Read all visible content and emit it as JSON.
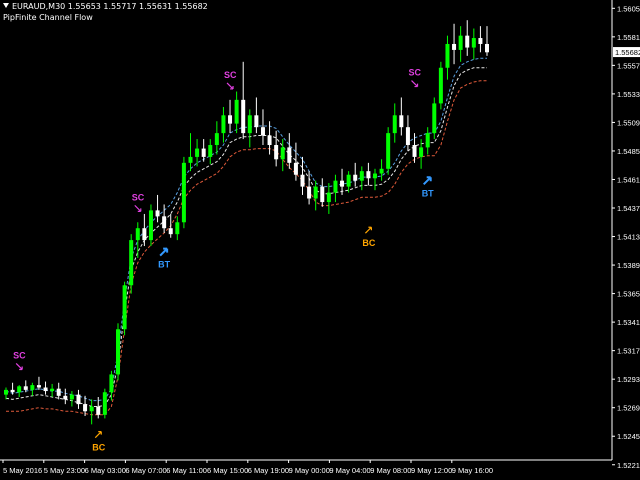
{
  "window": {
    "symbol_line": "EURAUD,M30  1.55653 1.55717 1.55631 1.55682",
    "indicator_name": "PipFinite Channel Flow"
  },
  "colors": {
    "background": "#000000",
    "bull_candle": "#00ff00",
    "bear_candle": "#ffffff",
    "upper_line": "#5aa0e0",
    "middle_line": "#e8e8e8",
    "lower_line": "#e05a3a",
    "sc_label": "#e040e0",
    "bt_label": "#3399ff",
    "bc_label": "#ffa500",
    "axis": "#ffffff",
    "current_price_bg": "#ffffff"
  },
  "chart_data": {
    "type": "line",
    "ylim": [
      1.5225,
      1.5612
    ],
    "y_ticks": [
      "1.56050",
      "1.55810",
      "1.55570",
      "1.55330",
      "1.55090",
      "1.54850",
      "1.54610",
      "1.54370",
      "1.54130",
      "1.53890",
      "1.53650",
      "1.53410",
      "1.53170",
      "1.52930",
      "1.52690",
      "1.52450",
      "1.52210"
    ],
    "y_tick_values": [
      1.5605,
      1.5581,
      1.5557,
      1.5533,
      1.5509,
      1.5485,
      1.5461,
      1.5437,
      1.5413,
      1.5389,
      1.5365,
      1.5341,
      1.5317,
      1.5293,
      1.5269,
      1.5245,
      1.5221
    ],
    "x_ticks": [
      "5 May 2016",
      "5 May 23:00",
      "6 May 03:00",
      "6 May 07:00",
      "6 May 11:00",
      "6 May 15:00",
      "6 May 19:00",
      "9 May 00:00",
      "9 May 04:00",
      "9 May 08:00",
      "9 May 12:00",
      "9 May 16:00"
    ],
    "current_price": "1.55682",
    "series": [
      {
        "values": [
          1.5283,
          1.5281,
          1.5282,
          1.5283,
          1.5284,
          1.5285,
          1.5284,
          1.5283,
          1.5283,
          1.5281,
          1.528,
          1.5279,
          1.5277,
          1.5275,
          1.5275,
          1.5276,
          1.5285,
          1.5315,
          1.536,
          1.5395,
          1.541,
          1.5418,
          1.5425,
          1.543,
          1.5435,
          1.544,
          1.545,
          1.5463,
          1.547,
          1.5475,
          1.5478,
          1.5481,
          1.5484,
          1.549,
          1.55,
          1.5503,
          1.5505,
          1.5505,
          1.5506,
          1.5506,
          1.5506,
          1.5504,
          1.5497,
          1.549,
          1.5484,
          1.5478,
          1.5468,
          1.5458,
          1.5455,
          1.5455,
          1.5456,
          1.5457,
          1.5458,
          1.546,
          1.5463,
          1.5463,
          1.5463,
          1.5464,
          1.5468,
          1.5475,
          1.5485,
          1.5492,
          1.5496,
          1.5498,
          1.55,
          1.55,
          1.551,
          1.553,
          1.5548,
          1.5557,
          1.556,
          1.5562,
          1.5563,
          1.5563
        ]
      },
      {
        "values": [
          1.5277,
          1.5276,
          1.5277,
          1.5278,
          1.5279,
          1.528,
          1.5279,
          1.5278,
          1.5277,
          1.5276,
          1.5275,
          1.5273,
          1.5272,
          1.527,
          1.527,
          1.5271,
          1.528,
          1.5305,
          1.535,
          1.5385,
          1.54,
          1.541,
          1.5416,
          1.5421,
          1.5426,
          1.5432,
          1.5442,
          1.5455,
          1.5462,
          1.5467,
          1.547,
          1.5473,
          1.5476,
          1.5482,
          1.5492,
          1.5495,
          1.5497,
          1.5497,
          1.5498,
          1.5498,
          1.5498,
          1.5496,
          1.5489,
          1.5482,
          1.5477,
          1.5471,
          1.5462,
          1.5452,
          1.5449,
          1.5449,
          1.545,
          1.5451,
          1.5452,
          1.5454,
          1.5456,
          1.5456,
          1.5456,
          1.5457,
          1.5461,
          1.5468,
          1.5478,
          1.5485,
          1.5489,
          1.5491,
          1.5492,
          1.5492,
          1.5502,
          1.5522,
          1.554,
          1.555,
          1.5553,
          1.5555,
          1.5555,
          1.5555
        ]
      },
      {
        "values": [
          1.5266,
          1.5266,
          1.5266,
          1.5267,
          1.5268,
          1.5269,
          1.5268,
          1.5268,
          1.5267,
          1.5266,
          1.5266,
          1.5265,
          1.5264,
          1.5263,
          1.5263,
          1.5263,
          1.527,
          1.5295,
          1.5335,
          1.5373,
          1.5391,
          1.54,
          1.5406,
          1.5411,
          1.5416,
          1.5422,
          1.5432,
          1.5445,
          1.5452,
          1.5457,
          1.546,
          1.5463,
          1.5466,
          1.5472,
          1.548,
          1.5484,
          1.5486,
          1.5486,
          1.5487,
          1.5487,
          1.5487,
          1.5485,
          1.5478,
          1.5471,
          1.5466,
          1.546,
          1.5452,
          1.5442,
          1.5439,
          1.5439,
          1.544,
          1.5441,
          1.5442,
          1.5444,
          1.5446,
          1.5446,
          1.5446,
          1.5447,
          1.545,
          1.5457,
          1.5467,
          1.5474,
          1.5478,
          1.548,
          1.5481,
          1.5481,
          1.549,
          1.551,
          1.5528,
          1.5538,
          1.5541,
          1.5543,
          1.5544,
          1.5544
        ]
      }
    ],
    "candles": [
      [
        1.528,
        1.5286,
        1.5276,
        1.5284
      ],
      [
        1.5284,
        1.529,
        1.528,
        1.5282
      ],
      [
        1.5282,
        1.5288,
        1.5278,
        1.5287
      ],
      [
        1.5287,
        1.5292,
        1.5282,
        1.5284
      ],
      [
        1.5284,
        1.529,
        1.5279,
        1.5288
      ],
      [
        1.5288,
        1.5295,
        1.5284,
        1.5286
      ],
      [
        1.5286,
        1.5291,
        1.528,
        1.5283
      ],
      [
        1.5283,
        1.5289,
        1.5278,
        1.5285
      ],
      [
        1.5285,
        1.529,
        1.5276,
        1.5279
      ],
      [
        1.5279,
        1.5285,
        1.5272,
        1.5276
      ],
      [
        1.5276,
        1.5283,
        1.527,
        1.528
      ],
      [
        1.528,
        1.5284,
        1.5268,
        1.5272
      ],
      [
        1.5272,
        1.5279,
        1.5262,
        1.5266
      ],
      [
        1.5266,
        1.5276,
        1.5255,
        1.527
      ],
      [
        1.527,
        1.5278,
        1.526,
        1.5263
      ],
      [
        1.5263,
        1.5285,
        1.526,
        1.5282
      ],
      [
        1.5282,
        1.53,
        1.5275,
        1.5297
      ],
      [
        1.5297,
        1.534,
        1.5292,
        1.5335
      ],
      [
        1.5335,
        1.5375,
        1.533,
        1.5372
      ],
      [
        1.5372,
        1.5415,
        1.5365,
        1.541
      ],
      [
        1.541,
        1.5425,
        1.5395,
        1.542
      ],
      [
        1.542,
        1.5432,
        1.5405,
        1.541
      ],
      [
        1.541,
        1.544,
        1.5405,
        1.5435
      ],
      [
        1.5435,
        1.5448,
        1.5425,
        1.543
      ],
      [
        1.543,
        1.544,
        1.5416,
        1.542
      ],
      [
        1.542,
        1.5432,
        1.5412,
        1.5415
      ],
      [
        1.5415,
        1.543,
        1.541,
        1.5425
      ],
      [
        1.5425,
        1.548,
        1.542,
        1.5475
      ],
      [
        1.5475,
        1.55,
        1.5468,
        1.548
      ],
      [
        1.548,
        1.5495,
        1.5472,
        1.5487
      ],
      [
        1.5487,
        1.5495,
        1.5476,
        1.548
      ],
      [
        1.548,
        1.5495,
        1.5474,
        1.549
      ],
      [
        1.549,
        1.551,
        1.5482,
        1.55
      ],
      [
        1.55,
        1.5522,
        1.5492,
        1.5515
      ],
      [
        1.5515,
        1.5528,
        1.55,
        1.5508
      ],
      [
        1.5508,
        1.5535,
        1.55,
        1.5528
      ],
      [
        1.5528,
        1.556,
        1.5495,
        1.55
      ],
      [
        1.55,
        1.552,
        1.5488,
        1.5515
      ],
      [
        1.5515,
        1.553,
        1.55,
        1.5505
      ],
      [
        1.5505,
        1.552,
        1.549,
        1.5498
      ],
      [
        1.5498,
        1.551,
        1.5482,
        1.549
      ],
      [
        1.549,
        1.5502,
        1.5472,
        1.5478
      ],
      [
        1.5478,
        1.5495,
        1.5468,
        1.5488
      ],
      [
        1.5488,
        1.55,
        1.547,
        1.5475
      ],
      [
        1.5475,
        1.5492,
        1.546,
        1.5465
      ],
      [
        1.5465,
        1.548,
        1.5448,
        1.5455
      ],
      [
        1.5455,
        1.5468,
        1.544,
        1.5445
      ],
      [
        1.5445,
        1.546,
        1.5435,
        1.5455
      ],
      [
        1.5455,
        1.5462,
        1.5438,
        1.5442
      ],
      [
        1.5442,
        1.5458,
        1.5432,
        1.545
      ],
      [
        1.545,
        1.5465,
        1.5442,
        1.546
      ],
      [
        1.546,
        1.547,
        1.5448,
        1.5455
      ],
      [
        1.5455,
        1.5468,
        1.545,
        1.5465
      ],
      [
        1.5465,
        1.5475,
        1.5455,
        1.546
      ],
      [
        1.546,
        1.5472,
        1.5452,
        1.5468
      ],
      [
        1.5468,
        1.5475,
        1.5456,
        1.5462
      ],
      [
        1.5462,
        1.547,
        1.5452,
        1.5466
      ],
      [
        1.5466,
        1.5478,
        1.546,
        1.547
      ],
      [
        1.547,
        1.5505,
        1.5465,
        1.55
      ],
      [
        1.55,
        1.5525,
        1.5492,
        1.5515
      ],
      [
        1.5515,
        1.553,
        1.5498,
        1.5505
      ],
      [
        1.5505,
        1.5515,
        1.5485,
        1.549
      ],
      [
        1.549,
        1.55,
        1.5475,
        1.548
      ],
      [
        1.548,
        1.5495,
        1.547,
        1.5488
      ],
      [
        1.5488,
        1.5505,
        1.5482,
        1.55
      ],
      [
        1.55,
        1.553,
        1.5495,
        1.5525
      ],
      [
        1.5525,
        1.556,
        1.552,
        1.5555
      ],
      [
        1.5555,
        1.5582,
        1.5545,
        1.5575
      ],
      [
        1.5575,
        1.5592,
        1.5558,
        1.557
      ],
      [
        1.557,
        1.559,
        1.556,
        1.5582
      ],
      [
        1.5582,
        1.5595,
        1.5565,
        1.5572
      ],
      [
        1.5572,
        1.5588,
        1.5562,
        1.558
      ],
      [
        1.558,
        1.559,
        1.5568,
        1.5575
      ],
      [
        1.5575,
        1.559,
        1.5565,
        1.5568
      ]
    ],
    "signals": [
      {
        "label": "SC",
        "index": 2,
        "price": 1.5302,
        "kind": "sc"
      },
      {
        "label": "BC",
        "index": 14,
        "price": 1.5248,
        "kind": "bc"
      },
      {
        "label": "SC",
        "index": 20,
        "price": 1.5435,
        "kind": "sc"
      },
      {
        "label": "BT",
        "index": 24,
        "price": 1.5402,
        "kind": "bt"
      },
      {
        "label": "SC",
        "index": 34,
        "price": 1.5538,
        "kind": "sc"
      },
      {
        "label": "BC",
        "index": 55,
        "price": 1.542,
        "kind": "bc"
      },
      {
        "label": "SC",
        "index": 62,
        "price": 1.554,
        "kind": "sc"
      },
      {
        "label": "BT",
        "index": 64,
        "price": 1.5462,
        "kind": "bt"
      }
    ]
  }
}
